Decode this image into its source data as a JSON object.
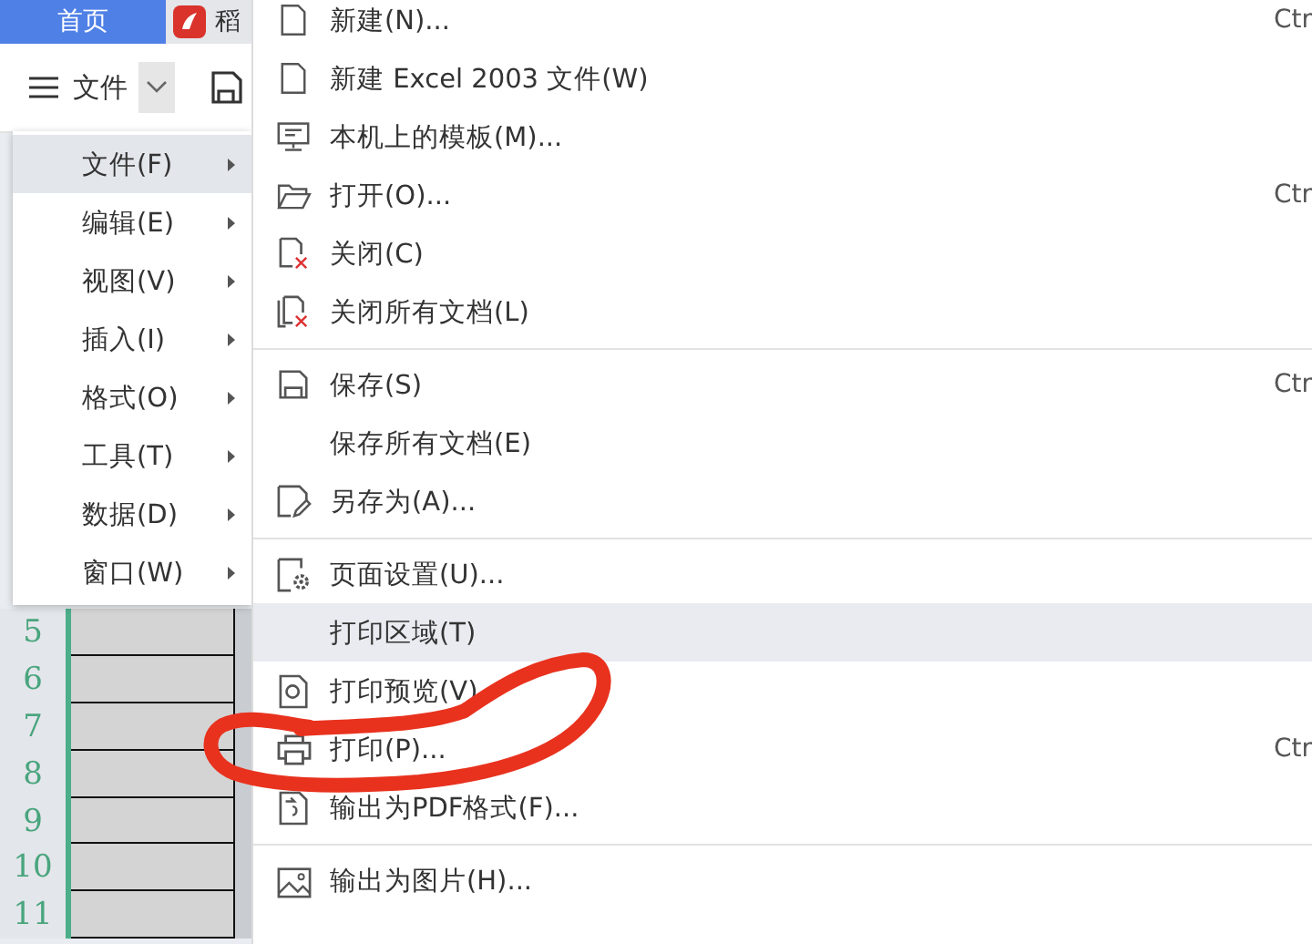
{
  "tabs": [
    {
      "label": "首页",
      "selected": true
    },
    {
      "label": "稻",
      "selected": false
    }
  ],
  "toolbar": {
    "menu_label": "文件"
  },
  "submenu": [
    {
      "label": "文件(F)",
      "selected": true
    },
    {
      "label": "编辑(E)",
      "selected": false
    },
    {
      "label": "视图(V)",
      "selected": false
    },
    {
      "label": "插入(I)",
      "selected": false
    },
    {
      "label": "格式(O)",
      "selected": false
    },
    {
      "label": "工具(T)",
      "selected": false
    },
    {
      "label": "数据(D)",
      "selected": false
    },
    {
      "label": "窗口(W)",
      "selected": false
    }
  ],
  "row_headers": [
    "5",
    "6",
    "7",
    "8",
    "9",
    "10",
    "11"
  ],
  "file_menu": {
    "groups": [
      [
        {
          "label": "新建(N)...",
          "shortcut": "Ctr",
          "selected": false
        },
        {
          "label": "新建 Excel 2003 文件(W)",
          "selected": false
        },
        {
          "label": "本机上的模板(M)...",
          "selected": false
        },
        {
          "label": "打开(O)...",
          "shortcut": "Ctr",
          "selected": false
        },
        {
          "label": "关闭(C)",
          "selected": false
        },
        {
          "label": "关闭所有文档(L)",
          "selected": false
        }
      ],
      [
        {
          "label": "保存(S)",
          "shortcut": "Ctr",
          "selected": false
        },
        {
          "label": "保存所有文档(E)",
          "selected": false
        },
        {
          "label": "另存为(A)...",
          "selected": false
        }
      ],
      [
        {
          "label": "页面设置(U)...",
          "selected": false
        },
        {
          "label": "打印区域(T)",
          "selected": true
        },
        {
          "label": "打印预览(V)",
          "selected": false
        },
        {
          "label": "打印(P)...",
          "shortcut": "Ctr",
          "selected": false
        },
        {
          "label": "输出为PDF格式(F)...",
          "selected": false
        }
      ],
      [
        {
          "label": "输出为图片(H)...",
          "selected": false
        }
      ]
    ]
  }
}
